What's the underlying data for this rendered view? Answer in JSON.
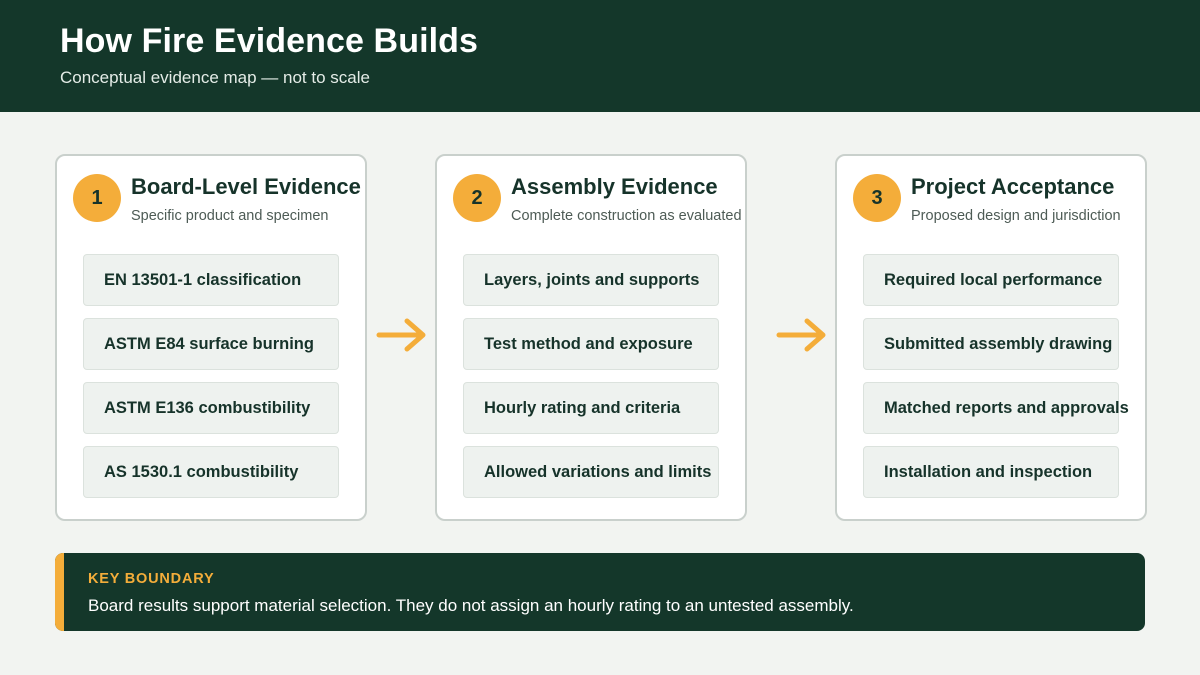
{
  "header": {
    "title": "How Fire Evidence Builds",
    "subtitle": "Conceptual evidence map — not to scale"
  },
  "stages": [
    {
      "number": "1",
      "title": "Board-Level Evidence",
      "subtitle": "Specific product and specimen",
      "items": [
        "EN 13501-1 classification",
        "ASTM E84 surface burning",
        "ASTM E136 combustibility",
        "AS 1530.1 combustibility"
      ]
    },
    {
      "number": "2",
      "title": "Assembly Evidence",
      "subtitle": "Complete construction as evaluated",
      "items": [
        "Layers, joints and supports",
        "Test method and exposure",
        "Hourly rating and criteria",
        "Allowed variations and limits"
      ]
    },
    {
      "number": "3",
      "title": "Project Acceptance",
      "subtitle": "Proposed design and jurisdiction",
      "items": [
        "Required local performance",
        "Submitted assembly drawing",
        "Matched reports and approvals",
        "Installation and inspection"
      ]
    }
  ],
  "callout": {
    "title": "KEY BOUNDARY",
    "text": "Board results support material selection. They do not assign an hourly rating to an untested assembly."
  },
  "colors": {
    "header_bg": "#14372a",
    "accent": "#f4ad3a",
    "card_border": "#c9d0cc",
    "item_bg": "#eef2ef"
  },
  "icons": {
    "connector": "right-arrow-icon"
  }
}
